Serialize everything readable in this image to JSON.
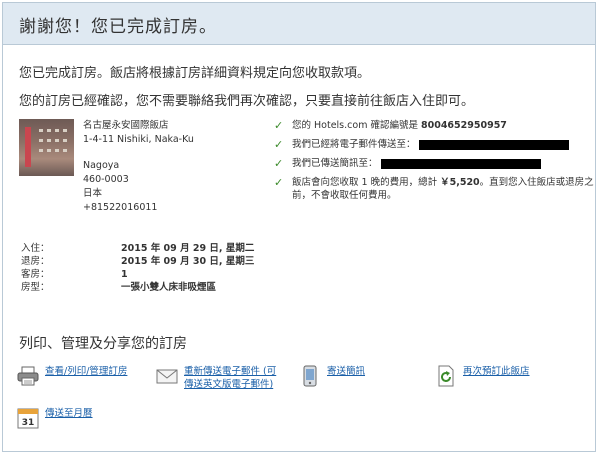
{
  "header": {
    "title": "謝謝您！您已完成訂房。"
  },
  "messages": {
    "line1": "您已完成訂房。飯店將根據訂房詳細資料規定向您收取款項。",
    "line2": "您的訂房已經確認，您不需要聯絡我們再次確認，只要直接前往飯店入住即可。"
  },
  "hotel": {
    "name": "名古屋永安國際飯店",
    "address": "1-4-11 Nishiki, Naka-Ku",
    "city": "Nagoya",
    "postal": "460-0003",
    "country": "日本",
    "phone": "+81522016011"
  },
  "confirmations": [
    {
      "text": "您的 Hotels.com 確認編號是 ",
      "bold": "8004652950957"
    },
    {
      "text": "我們已經將電子郵件傳送至："
    },
    {
      "text": "我們已傳送簡訊至："
    },
    {
      "text": "飯店會向您收取 1 晚的費用，總計 ",
      "bold": "￥5,520",
      "tail": "。直到您入住飯店或退房之前，不會收取任何費用。"
    }
  ],
  "details": [
    {
      "label": "入住：",
      "value": "2015 年 09 月 29 日, 星期二"
    },
    {
      "label": "退房：",
      "value": "2015 年 09 月 30 日, 星期三"
    },
    {
      "label": "客房：",
      "value": "1"
    },
    {
      "label": "房型：",
      "value": "一張小雙人床非吸煙區"
    }
  ],
  "actions_section": {
    "title": "列印、管理及分享您的訂房"
  },
  "actions": {
    "print": "查看/列印/管理訂房",
    "resend": "重新傳送電子郵件 (可傳送英文版電子郵件)",
    "sms": "寄送簡訊",
    "rebook": "再次預訂此飯店",
    "calendar": "傳送至月曆",
    "calendar_day": "31"
  },
  "colors": {
    "accent": "#1a5fa8",
    "header_bg": "#dfe9f2",
    "check": "#3b8a2a"
  }
}
